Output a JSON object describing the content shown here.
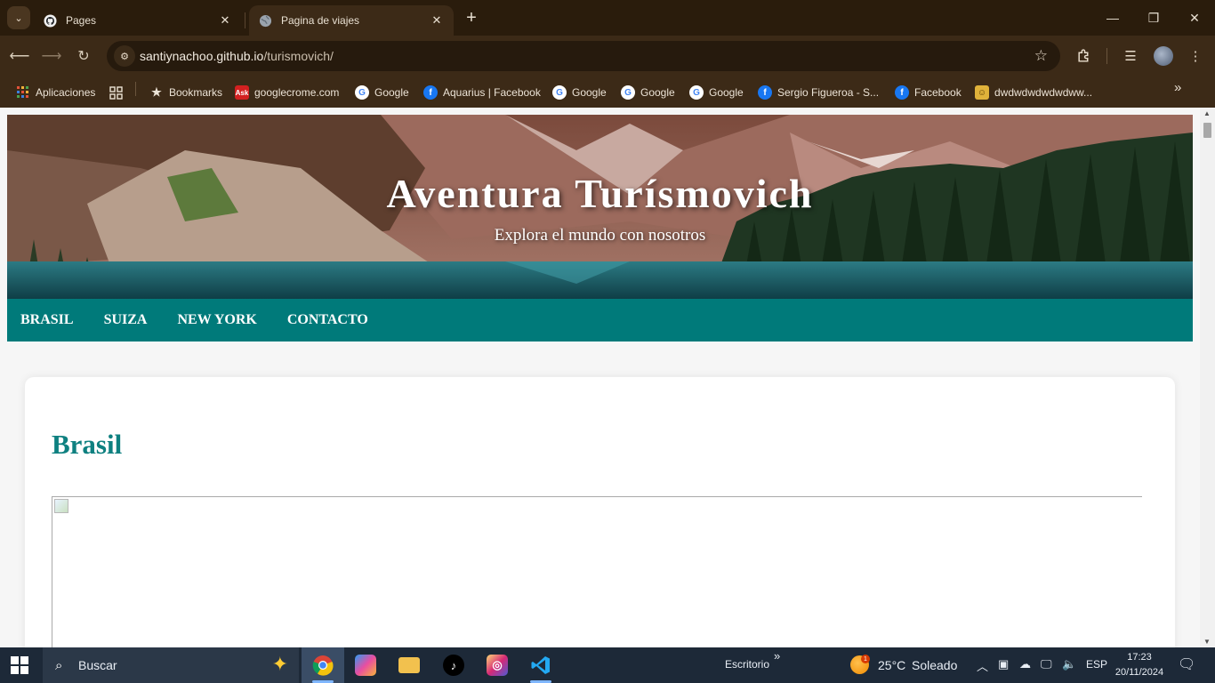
{
  "browser": {
    "tabs": [
      {
        "title": "Pages",
        "icon": "github-icon",
        "active": false
      },
      {
        "title": "Pagina de viajes",
        "icon": "globe-icon",
        "active": true
      }
    ],
    "url_domain": "santiynachoo.github.io",
    "url_path": "/turismovich/",
    "bookmarks": [
      {
        "label": "Aplicaciones",
        "icon": "apps-grid-icon"
      },
      {
        "label": "",
        "icon": "tab-groups-icon"
      },
      {
        "label": "Bookmarks",
        "icon": "star-icon"
      },
      {
        "label": "googlecrome.com",
        "icon": "ask-icon"
      },
      {
        "label": "Google",
        "icon": "google-icon"
      },
      {
        "label": "Aquarius | Facebook",
        "icon": "facebook-icon"
      },
      {
        "label": "Google",
        "icon": "google-icon"
      },
      {
        "label": "Google",
        "icon": "google-icon"
      },
      {
        "label": "Google",
        "icon": "google-icon"
      },
      {
        "label": "Sergio Figueroa - S...",
        "icon": "facebook-icon"
      },
      {
        "label": "Facebook",
        "icon": "facebook-icon"
      },
      {
        "label": "dwdwdwdwdwdww...",
        "icon": "bookmark-favicon-icon"
      }
    ]
  },
  "page": {
    "hero_title": "Aventura Turísmovich",
    "hero_subtitle": "Explora el mundo con nosotros",
    "nav": [
      "BRASIL",
      "SUIZA",
      "NEW YORK",
      "CONTACTO"
    ],
    "section_title": "Brasil",
    "colors": {
      "accent": "#007a7a",
      "heading": "#0e8080"
    }
  },
  "taskbar": {
    "search_placeholder": "Buscar",
    "desktop_label": "Escritorio",
    "weather_temp": "25°C",
    "weather_desc": "Soleado",
    "weather_badge": "1",
    "language": "ESP",
    "time": "17:23",
    "date": "20/11/2024"
  }
}
